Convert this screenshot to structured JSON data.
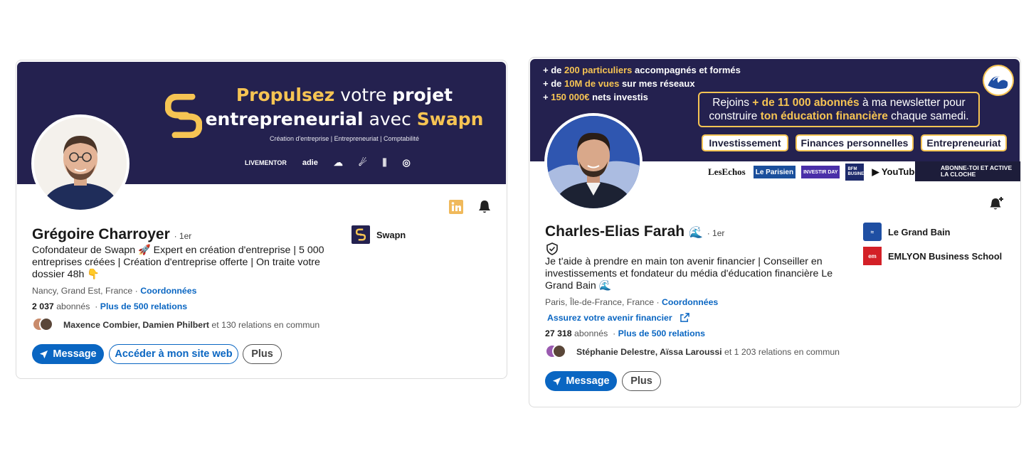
{
  "card1": {
    "banner": {
      "title_hl1": "Propulsez",
      "title_lt1": " votre ",
      "title_hl2": "projet",
      "title_line2a": "entrepreneurial",
      "title_line2b": " avec ",
      "title_hl3": "Swapn",
      "subtitle": "Création d'entreprise | Entrepreneuriat | Comptabilité",
      "partners": [
        "LIVEMENTOR",
        "adie",
        "☁︎",
        "☄",
        "⫼",
        "◎"
      ]
    },
    "name": "Grégoire Charroyer",
    "degree": "· 1er",
    "headline": "Cofondateur de Swapn 🚀 Expert en création d'entreprise | 5 000 entreprises créées | Création d'entreprise offerte | On traite votre dossier 48h 👇",
    "location": "Nancy, Grand Est, France ·",
    "contact_link": "Coordonnées",
    "followers": "2 037",
    "followers_label": "abonnés",
    "relations_link": "Plus de 500 relations",
    "mutual_names": "Maxence Combier, Damien Philbert",
    "mutual_rest": " et 130 relations en commun",
    "company": "Swapn",
    "buttons": {
      "message": "Message",
      "website": "Accéder à mon site web",
      "more": "Plus"
    }
  },
  "card2": {
    "banner": {
      "line1_pre": "+ de ",
      "line1_hl": "200 particuliers",
      "line1_post": " accompagnés et formés",
      "line2_pre": "+ de ",
      "line2_hl": "10M de vues",
      "line2_post": " sur mes réseaux",
      "line3_pre": "+ ",
      "line3_hl": "150 000€",
      "line3_post": " nets investis",
      "news_a": "Rejoins ",
      "news_hl1": "+ de 11 000 abonnés",
      "news_b": " à ma newsletter pour",
      "news_c": "construire ",
      "news_hl2": "ton éducation financière",
      "news_d": " chaque samedi.",
      "tags": [
        "Investissement",
        "Finances personnelles",
        "Entrepreneuriat"
      ],
      "medias": [
        "LesEchos",
        "Le Parisien",
        "INVESTIR DAY",
        "BFM BUSINESS",
        "▶ YouTube"
      ],
      "cta": "ABONNE-TOI ET ACTIVE LA CLOCHE"
    },
    "name": "Charles-Elias Farah",
    "name_emoji": "🌊",
    "degree": "· 1er",
    "headline": "Je t'aide à prendre en main ton avenir financier | Conseiller en investissements et fondateur du média d'éducation financière Le Grand Bain 🌊",
    "location": "Paris, Île-de-France, France ·",
    "contact_link": "Coordonnées",
    "website_link": "Assurez votre avenir financier",
    "followers": "27 318",
    "followers_label": "abonnés",
    "relations_link": "Plus de 500 relations",
    "mutual_names": "Stéphanie Delestre, Aïssa Laroussi",
    "mutual_rest": " et 1 203 relations en commun",
    "companies": [
      "Le Grand Bain",
      "EMLYON Business School"
    ],
    "buttons": {
      "message": "Message",
      "more": "Plus"
    }
  },
  "colors": {
    "linkedin_blue": "#0a66c2",
    "banner_navy": "#24214f",
    "accent_gold": "#f6c453"
  }
}
